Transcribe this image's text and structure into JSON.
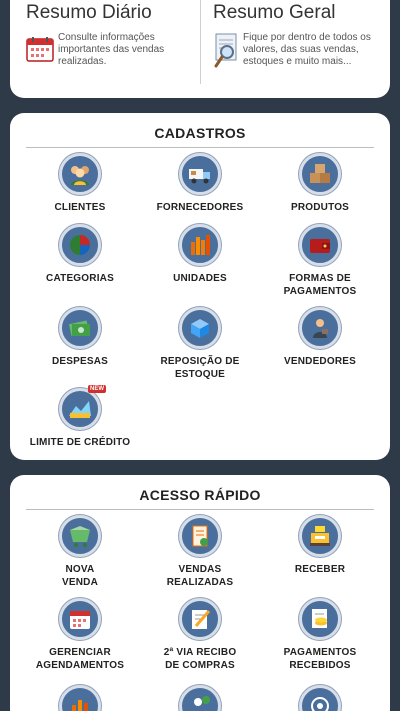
{
  "summary": {
    "daily": {
      "title": "Resumo Diário",
      "text": "Consulte informações importantes das vendas realizadas.",
      "icon": "calendar-icon"
    },
    "general": {
      "title": "Resumo Geral",
      "text": "Fique por dentro de todos os valores, das suas vendas, estoques e muito mais...",
      "icon": "search-document-icon"
    }
  },
  "cadastros": {
    "title": "CADASTROS",
    "items": [
      {
        "label": "CLIENTES",
        "icon": "users-icon"
      },
      {
        "label": "FORNECEDORES",
        "icon": "truck-icon"
      },
      {
        "label": "PRODUTOS",
        "icon": "boxes-icon"
      },
      {
        "label": "CATEGORIAS",
        "icon": "pie-chart-icon"
      },
      {
        "label": "UNIDADES",
        "icon": "bar-chart-icon"
      },
      {
        "label": "FORMAS DE\nPAGAMENTOS",
        "icon": "wallet-icon"
      },
      {
        "label": "DESPESAS",
        "icon": "money-icon"
      },
      {
        "label": "REPOSIÇÃO DE\nESTOQUE",
        "icon": "box-restock-icon"
      },
      {
        "label": "VENDEDORES",
        "icon": "seller-icon"
      },
      {
        "label": "LIMITE DE CRÉDITO",
        "icon": "credit-limit-icon",
        "badge": "NEW"
      }
    ]
  },
  "acesso_rapido": {
    "title": "ACESSO RÁPIDO",
    "items": [
      {
        "label": "NOVA\nVENDA",
        "icon": "cart-icon"
      },
      {
        "label": "VENDAS\nREALIZADAS",
        "icon": "receipt-icon"
      },
      {
        "label": "RECEBER",
        "icon": "cash-register-icon"
      },
      {
        "label": "GERENCIAR\nAGENDAMENTOS",
        "icon": "calendar-icon"
      },
      {
        "label": "2ª VIA RECIBO\nDE COMPRAS",
        "icon": "pen-document-icon"
      },
      {
        "label": "PAGAMENTOS\nRECEBIDOS",
        "icon": "coins-document-icon"
      }
    ]
  },
  "colors": {
    "background": "#2f3a48",
    "card": "#ffffff",
    "icon_circle": "#4b6f9c"
  }
}
